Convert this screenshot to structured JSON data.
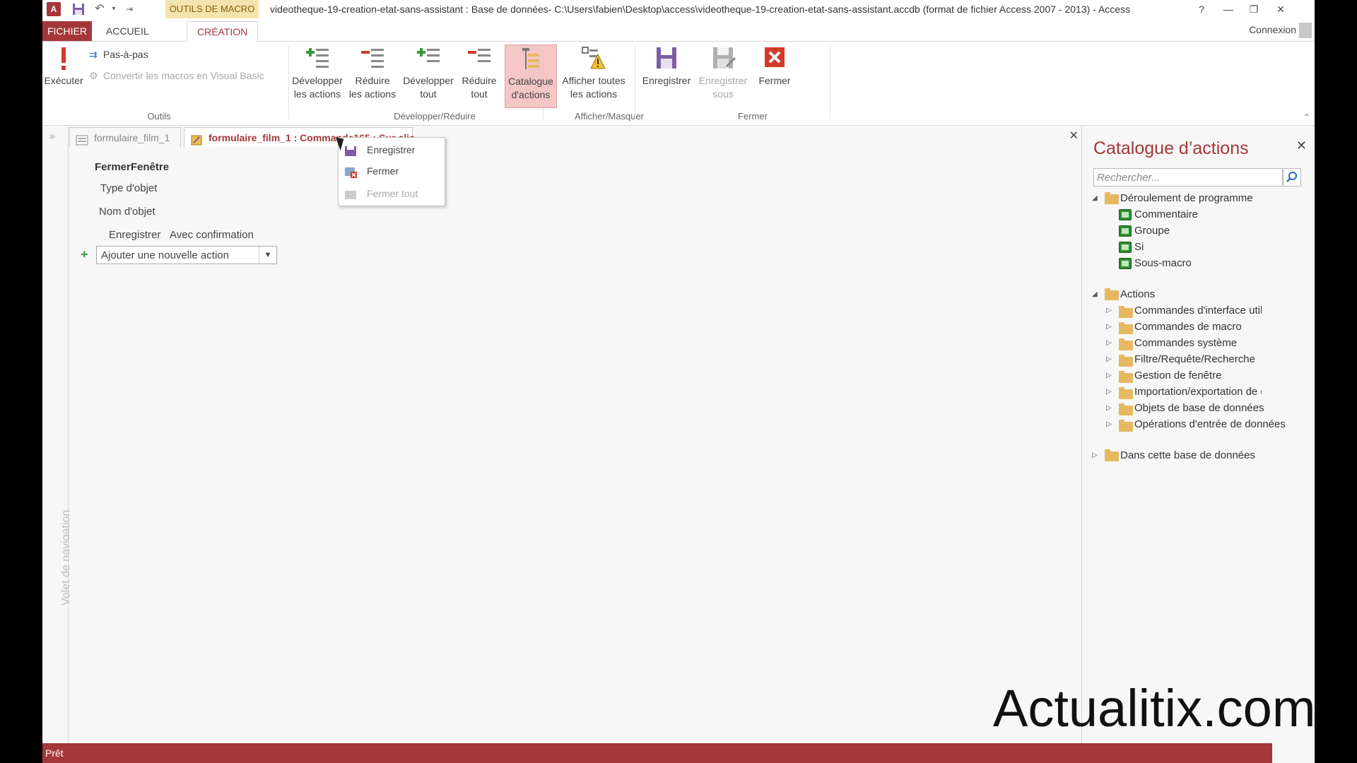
{
  "titlebar": {
    "app_icon": "A",
    "tools_tab": "OUTILS DE MACRO",
    "title": "videotheque-19-creation-etat-sans-assistant : Base de données- C:\\Users\\fabien\\Desktop\\access\\videotheque-19-creation-etat-sans-assistant.accdb (format de fichier Access 2007 - 2013) - Access",
    "help": "?",
    "minimize": "—",
    "restore": "❐",
    "close": "✕"
  },
  "tabs": {
    "file": "FICHIER",
    "home": "ACCUEIL",
    "create": "CRÉATION",
    "connexion": "Connexion"
  },
  "ribbon": {
    "tools": {
      "run": "Exécuter",
      "step": "Pas-à-pas",
      "convert": "Convertir les macros en Visual Basic",
      "label": "Outils"
    },
    "expand": {
      "expand_actions_1": "Développer",
      "expand_actions_2": "les actions",
      "collapse_actions_1": "Réduire",
      "collapse_actions_2": "les actions",
      "expand_all_1": "Développer",
      "expand_all_2": "tout",
      "collapse_all_1": "Réduire",
      "collapse_all_2": "tout",
      "label": "Développer/Réduire"
    },
    "show": {
      "catalog_1": "Catalogue",
      "catalog_2": "d'actions",
      "show_all_1": "Afficher toutes",
      "show_all_2": "les actions",
      "label": "Afficher/Masquer"
    },
    "close": {
      "save": "Enregistrer",
      "save_as_1": "Enregistrer",
      "save_as_2": "sous",
      "close": "Fermer",
      "label": "Fermer"
    }
  },
  "nav": {
    "label": "Volet de navigation",
    "arrow": "»"
  },
  "doc_tabs": [
    {
      "label": "formulaire_film_1"
    },
    {
      "label": "formulaire_film_1 : Commande165 : Sur clic"
    }
  ],
  "macro": {
    "title": "FermerFenêtre",
    "type_label": "Type d'objet",
    "name_label": "Nom d'objet",
    "save_label": "Enregistrer",
    "save_value": "Avec confirmation",
    "add_action": "Ajouter une nouvelle action"
  },
  "context_menu": [
    {
      "label": "Enregistrer",
      "enabled": true
    },
    {
      "label": "Fermer",
      "enabled": true
    },
    {
      "label": "Fermer tout",
      "enabled": false
    }
  ],
  "catalog": {
    "title": "Catalogue d’actions",
    "search_placeholder": "Rechercher...",
    "sections": [
      {
        "label": "Déroulement de programme",
        "items": [
          "Commentaire",
          "Groupe",
          "Si",
          "Sous-macro"
        ]
      },
      {
        "label": "Actions",
        "items": [
          "Commandes d'interface utilisateur",
          "Commandes de macro",
          "Commandes système",
          "Filtre/Requête/Recherche",
          "Gestion de fenêtre",
          "Importation/exportation de données",
          "Objets de base de données",
          "Opérations d'entrée de données"
        ]
      },
      {
        "label": "Dans cette base de données",
        "items": []
      }
    ]
  },
  "status": {
    "text": "Prêt"
  },
  "watermark": "Actualitix.com",
  "colors": {
    "accent": "#a4373a",
    "tools_tab": "#f5e3ae",
    "green": "#2d8c2d",
    "folder": "#e6b860"
  }
}
